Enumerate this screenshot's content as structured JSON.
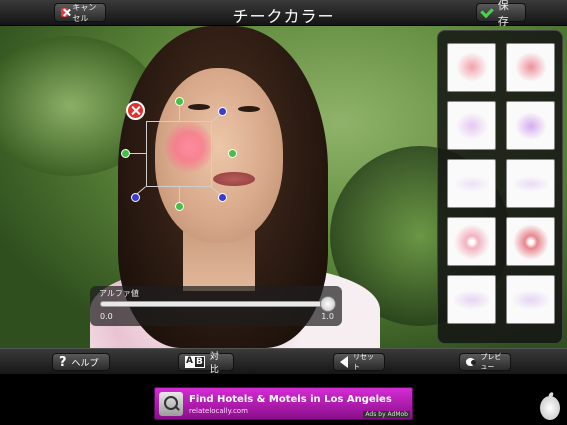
{
  "header": {
    "title": "チークカラー",
    "cancel_label": "キャンセル",
    "save_label": "保存"
  },
  "alpha": {
    "label": "アルファ値",
    "min_label": "0.0",
    "max_label": "1.0",
    "value": 1.0
  },
  "swatches": [
    {
      "name": "pink-cheek-1",
      "color": "#f2a0aa"
    },
    {
      "name": "pink-cheek-2",
      "color": "#ef8f9c"
    },
    {
      "name": "lavender-1",
      "color": "#e6c7f0"
    },
    {
      "name": "lavender-2",
      "color": "#d6aaf0"
    },
    {
      "name": "lavender-highlight-1",
      "color": "#efe0f6"
    },
    {
      "name": "lavender-highlight-2",
      "color": "#eadbf6"
    },
    {
      "name": "pink-gloss-1",
      "color": "#f3b2c0"
    },
    {
      "name": "pink-gloss-2",
      "color": "#e9868f"
    },
    {
      "name": "wing-1",
      "color": "#e6d4f4"
    },
    {
      "name": "wing-2",
      "color": "#e6d4f4"
    }
  ],
  "toolbar": {
    "help_label": "ヘルプ",
    "ab_left": "A",
    "ab_right": "B",
    "compare_label": "対比",
    "reset_label": "リセット",
    "preview_label": "プレビュー"
  },
  "ad": {
    "title": "Find Hotels & Motels in Los Angeles",
    "url": "relatelocally.com",
    "byline": "Ads by AdMob"
  },
  "colors": {
    "accent_green": "#42c142",
    "accent_blue": "#3b3bd0",
    "close_red": "#e23030",
    "ad_purple": "#b81db8"
  }
}
